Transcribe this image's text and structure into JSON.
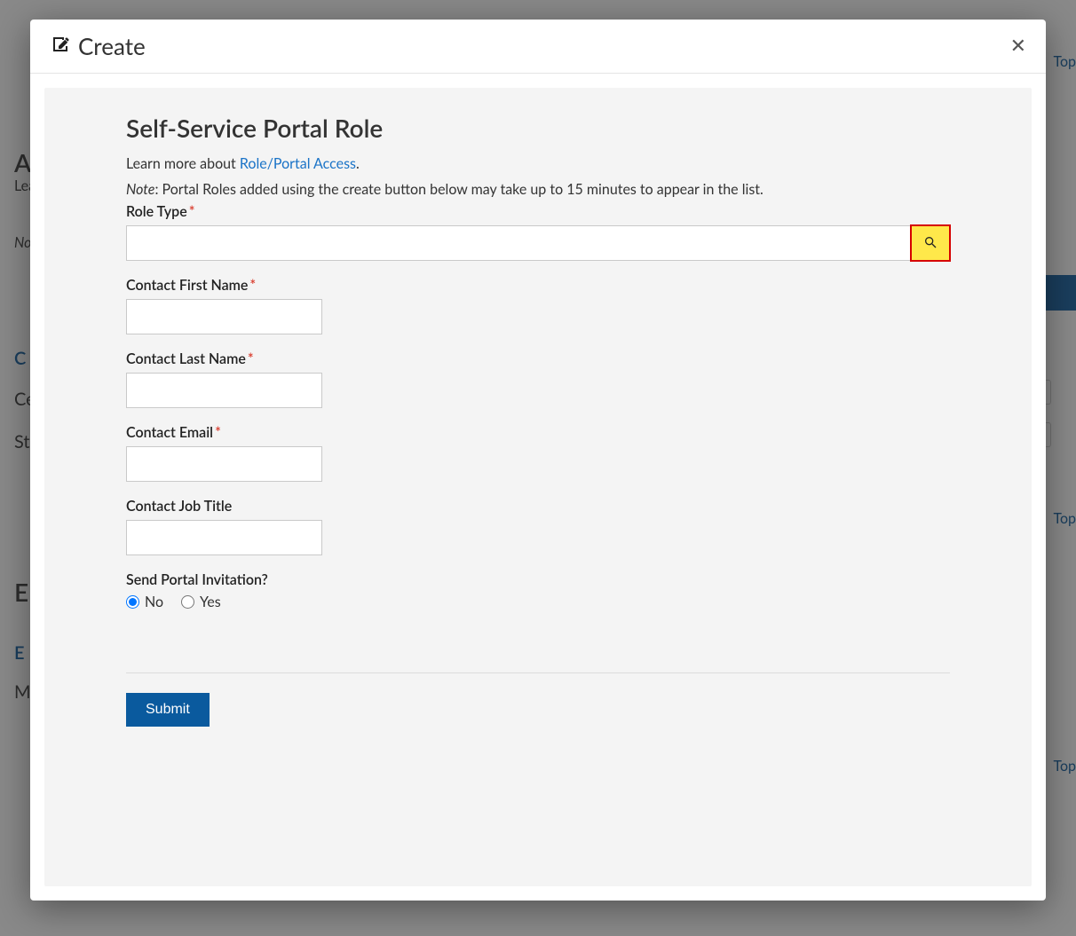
{
  "background": {
    "top_links": [
      "Top",
      "Top",
      "Top"
    ],
    "heading1_fragment": "A",
    "learn_fragment": "Lea",
    "note_fragment": "No",
    "tab1_fragment": "C",
    "row1_fragment": "Ce",
    "row2_fragment": "St",
    "heading2_fragment": "E",
    "tab2_fragment": "E",
    "row3_fragment": "M"
  },
  "modal": {
    "title": "Create",
    "form": {
      "heading": "Self-Service Portal Role",
      "intro_prefix": "Learn more about ",
      "intro_link": "Role/Portal Access",
      "intro_suffix": ".",
      "note_label": "Note",
      "note_text": ": Portal Roles added using the create button below may take up to 15 minutes to appear in the list.",
      "fields": {
        "role_type": {
          "label": "Role Type",
          "required": true,
          "value": ""
        },
        "first_name": {
          "label": "Contact First Name",
          "required": true,
          "value": ""
        },
        "last_name": {
          "label": "Contact Last Name",
          "required": true,
          "value": ""
        },
        "email": {
          "label": "Contact Email",
          "required": true,
          "value": ""
        },
        "job_title": {
          "label": "Contact Job Title",
          "required": false,
          "value": ""
        }
      },
      "invitation": {
        "label": "Send Portal Invitation?",
        "options": {
          "no": "No",
          "yes": "Yes"
        },
        "selected": "no"
      },
      "submit_label": "Submit"
    }
  }
}
